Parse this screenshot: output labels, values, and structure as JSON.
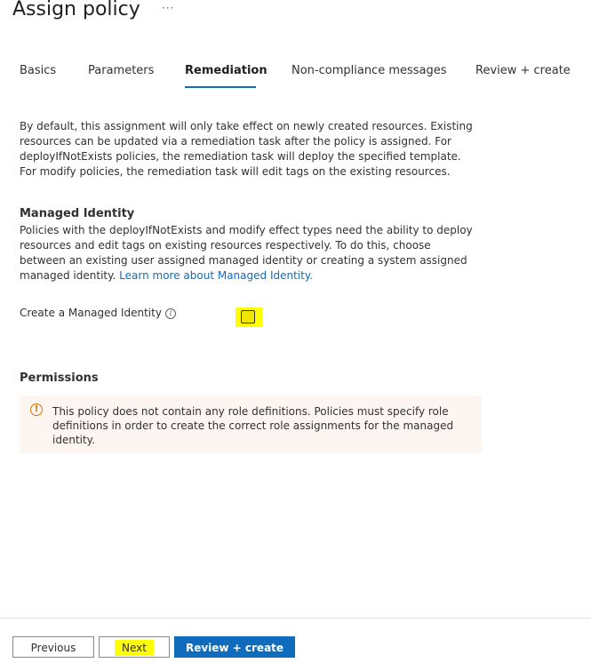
{
  "header": {
    "title": "Assign policy",
    "more": "···"
  },
  "tabs": [
    {
      "label": "Basics",
      "active": false
    },
    {
      "label": "Parameters",
      "active": false
    },
    {
      "label": "Remediation",
      "active": true
    },
    {
      "label": "Non-compliance messages",
      "active": false
    },
    {
      "label": "Review + create",
      "active": false
    }
  ],
  "intro": "By default, this assignment will only take effect on newly created resources. Existing resources can be updated via a remediation task after the policy is assigned. For deployIfNotExists policies, the remediation task will deploy the specified template. For modify policies, the remediation task will edit tags on the existing resources.",
  "managed_identity": {
    "title": "Managed Identity",
    "description": "Policies with the deployIfNotExists and modify effect types need the ability to deploy resources and edit tags on existing resources respectively. To do this, choose between an existing user assigned managed identity or creating a system assigned managed identity.",
    "link": "Learn more about Managed Identity.",
    "field_label": "Create a Managed Identity",
    "info_icon": "i",
    "checked": false
  },
  "permissions": {
    "title": "Permissions",
    "warning_icon": "!",
    "warning": "This policy does not contain any role definitions. Policies must specify role definitions in order to create the correct role assignments for the managed identity."
  },
  "footer": {
    "previous": "Previous",
    "next": "Next",
    "review_create": "Review + create"
  },
  "colors": {
    "accent": "#0f6cbd",
    "highlight": "#ffff00",
    "warning": "#d47500"
  }
}
